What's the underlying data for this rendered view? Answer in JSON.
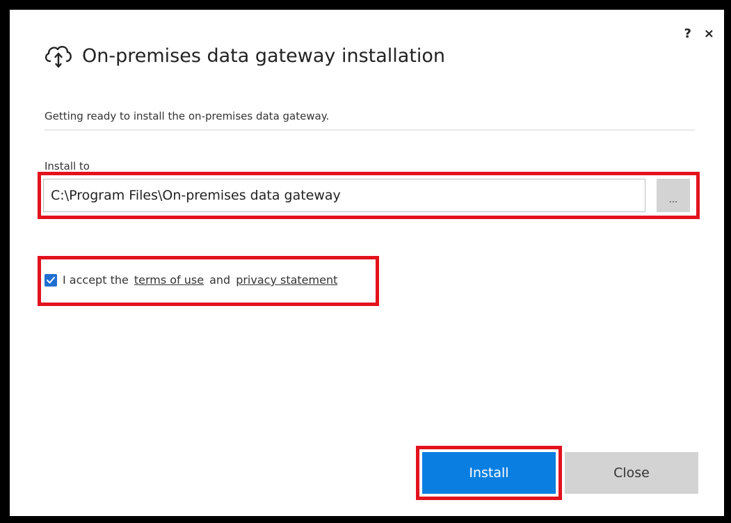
{
  "window": {
    "help_label": "?",
    "close_label": "×"
  },
  "header": {
    "icon": "cloud-upload-icon",
    "title": "On-premises data gateway installation"
  },
  "status": {
    "message": "Getting ready to install the on-premises data gateway."
  },
  "install_location": {
    "label": "Install to",
    "value": "C:\\Program Files\\On-premises data gateway",
    "browse_label": "..."
  },
  "terms": {
    "checked": true,
    "prefix": "I accept the",
    "terms_link": "terms of use",
    "conjunction": "and",
    "privacy_link": "privacy statement"
  },
  "actions": {
    "install_label": "Install",
    "close_label": "Close"
  },
  "colors": {
    "accent": "#0a7fe1",
    "highlight": "#e3121d",
    "secondary_button": "#d3d3d3"
  }
}
